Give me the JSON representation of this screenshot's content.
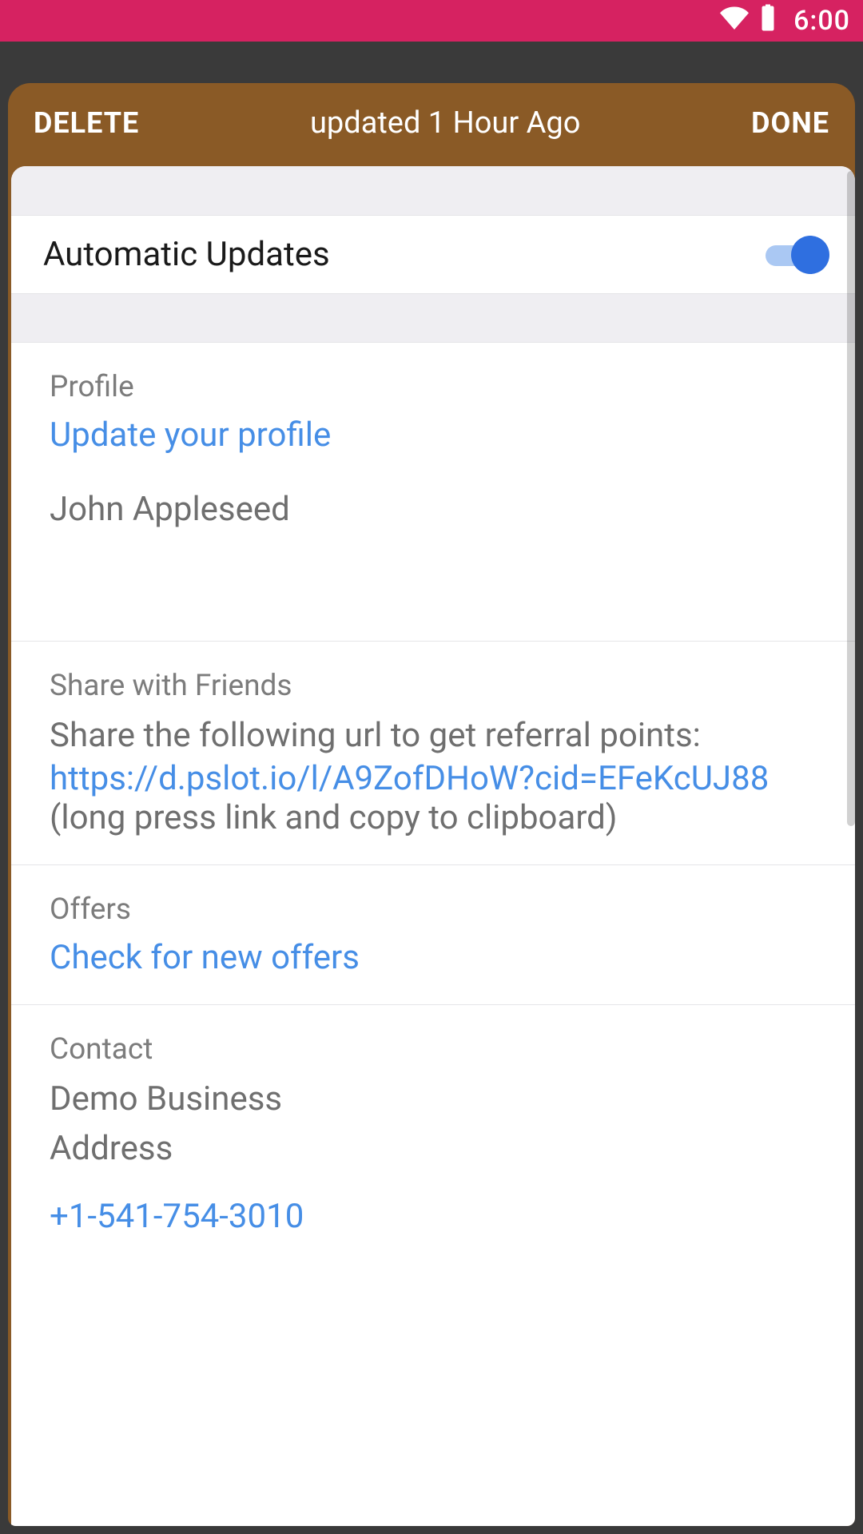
{
  "status": {
    "time": "6:00"
  },
  "toolbar": {
    "delete_label": "DELETE",
    "title": "updated 1 Hour Ago",
    "done_label": "DONE"
  },
  "auto_updates": {
    "label": "Automatic Updates",
    "enabled": true
  },
  "profile": {
    "header": "Profile",
    "link": "Update your profile",
    "name": "John Appleseed"
  },
  "share": {
    "header": "Share with Friends",
    "lead": "Share the following url to get referral points:",
    "url": "https://d.pslot.io/l/A9ZofDHoW?cid=EFeKcUJ88",
    "hint": "(long press link and copy to clipboard)"
  },
  "offers": {
    "header": "Offers",
    "link": "Check for new offers"
  },
  "contact": {
    "header": "Contact",
    "line1": "Demo Business",
    "line2": "Address",
    "phone": "+1-541-754-3010"
  }
}
